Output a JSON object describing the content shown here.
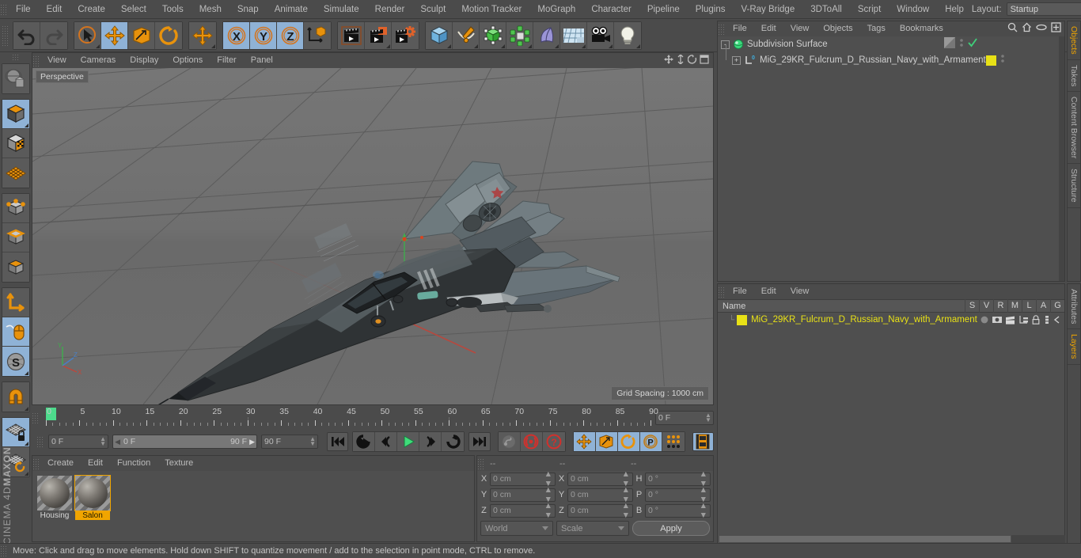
{
  "app": {
    "brand_top": "MAXON",
    "brand_bottom": "CINEMA 4D"
  },
  "topmenu": {
    "items": [
      "File",
      "Edit",
      "Create",
      "Select",
      "Tools",
      "Mesh",
      "Snap",
      "Animate",
      "Simulate",
      "Render",
      "Sculpt",
      "Motion Tracker",
      "MoGraph",
      "Character",
      "Pipeline",
      "Plugins",
      "V-Ray Bridge",
      "3DToAll",
      "Script",
      "Window",
      "Help"
    ],
    "layout_label": "Layout:",
    "layout_value": "Startup",
    "search_icon": "search-icon"
  },
  "toolbar": {
    "groups": [
      {
        "name": "undo-redo",
        "buttons": [
          {
            "name": "undo",
            "icon": "undo-arrow-icon",
            "selected": false,
            "corner": false
          },
          {
            "name": "redo",
            "icon": "redo-arrow-icon",
            "selected": false,
            "corner": false
          }
        ]
      },
      {
        "name": "transform",
        "buttons": [
          {
            "name": "live-selection",
            "icon": "cursor-circle-icon",
            "selected": false,
            "corner": true
          },
          {
            "name": "move",
            "icon": "move-cross-icon",
            "selected": true,
            "corner": false
          },
          {
            "name": "scale",
            "icon": "scale-box-icon",
            "selected": false,
            "corner": false
          },
          {
            "name": "rotate",
            "icon": "rotate-icon",
            "selected": false,
            "corner": false
          }
        ]
      },
      {
        "name": "move-duplicate",
        "buttons": [
          {
            "name": "move-tool-2",
            "icon": "move-cross-icon",
            "selected": false,
            "corner": true
          }
        ]
      },
      {
        "name": "axis-lock",
        "buttons": [
          {
            "name": "lock-x",
            "icon": "x-axis-icon",
            "selected": true,
            "corner": false
          },
          {
            "name": "lock-y",
            "icon": "y-axis-icon",
            "selected": true,
            "corner": false
          },
          {
            "name": "lock-z",
            "icon": "z-axis-icon",
            "selected": true,
            "corner": false
          },
          {
            "name": "world-object-coords",
            "icon": "world-axis-cube-icon",
            "selected": false,
            "corner": false
          }
        ]
      },
      {
        "name": "render",
        "buttons": [
          {
            "name": "render-view",
            "icon": "clapperboard-icon",
            "selected": false,
            "corner": false
          },
          {
            "name": "render-region",
            "icon": "clapperboard-region-icon",
            "selected": false,
            "corner": true
          },
          {
            "name": "render-settings",
            "icon": "clapperboard-gear-icon",
            "selected": false,
            "corner": false
          }
        ]
      },
      {
        "name": "create",
        "buttons": [
          {
            "name": "add-cube",
            "icon": "cube-icon",
            "selected": false,
            "corner": true
          },
          {
            "name": "add-spline",
            "icon": "pen-spline-icon",
            "selected": false,
            "corner": true
          },
          {
            "name": "add-nurbs",
            "icon": "green-cube-generator-icon",
            "selected": false,
            "corner": true
          },
          {
            "name": "add-array",
            "icon": "green-array-icon",
            "selected": false,
            "corner": true
          },
          {
            "name": "add-deformer",
            "icon": "bend-deformer-icon",
            "selected": false,
            "corner": true
          },
          {
            "name": "add-environment",
            "icon": "floor-grid-icon",
            "selected": false,
            "corner": true
          },
          {
            "name": "add-camera",
            "icon": "camera-icon",
            "selected": false,
            "corner": true
          },
          {
            "name": "add-light",
            "icon": "light-bulb-icon",
            "selected": false,
            "corner": true
          }
        ]
      }
    ]
  },
  "lefttools": {
    "groups": [
      {
        "name": "globe",
        "buttons": [
          {
            "name": "make-editable",
            "icon": "globe-wire-icon",
            "selected": false,
            "corner": false
          }
        ]
      },
      {
        "name": "mode-model",
        "buttons": [
          {
            "name": "model-mode",
            "icon": "grey-cube-icon",
            "selected": true,
            "corner": true
          },
          {
            "name": "texture-mode",
            "icon": "checker-cube-icon",
            "selected": false,
            "corner": false
          },
          {
            "name": "uv-mesh-mode",
            "icon": "orange-mesh-icon",
            "selected": false,
            "corner": false
          }
        ]
      },
      {
        "name": "mode-components",
        "buttons": [
          {
            "name": "points-mode",
            "icon": "points-cube-icon",
            "selected": false,
            "corner": false
          },
          {
            "name": "edges-mode",
            "icon": "edges-cube-icon",
            "selected": false,
            "corner": false
          },
          {
            "name": "polygons-mode",
            "icon": "polygons-cube-icon",
            "selected": false,
            "corner": false
          }
        ]
      },
      {
        "name": "axis",
        "buttons": [
          {
            "name": "enable-axis",
            "icon": "axis-corner-icon",
            "selected": false,
            "corner": false
          },
          {
            "name": "viewport-solo",
            "icon": "mouse-icon",
            "selected": true,
            "corner": false
          },
          {
            "name": "workplane",
            "icon": "s-disc-icon",
            "selected": true,
            "corner": true
          }
        ]
      },
      {
        "name": "snap",
        "buttons": [
          {
            "name": "enable-snap",
            "icon": "magnet-icon",
            "selected": false,
            "corner": true
          }
        ]
      },
      {
        "name": "workplane-lock",
        "buttons": [
          {
            "name": "lock-workplane",
            "icon": "grid-lock-icon",
            "selected": true,
            "corner": true
          },
          {
            "name": "planar-workplane",
            "icon": "grid-rotate-icon",
            "selected": false,
            "corner": true
          }
        ]
      }
    ]
  },
  "viewport": {
    "menu": [
      "View",
      "Cameras",
      "Display",
      "Options",
      "Filter",
      "Panel"
    ],
    "view_label": "Perspective",
    "grid_spacing": "Grid Spacing : 1000 cm",
    "axis_labels": {
      "x": "X",
      "y": "Y",
      "z": "Z"
    },
    "corner_icons": [
      "move-view-icon",
      "scale-view-icon",
      "rotate-view-icon",
      "maximize-view-icon"
    ]
  },
  "timeline": {
    "ticks": [
      0,
      5,
      10,
      15,
      20,
      25,
      30,
      35,
      40,
      45,
      50,
      55,
      60,
      65,
      70,
      75,
      80,
      85,
      90
    ],
    "current_frame_field": "0 F",
    "playhead_frame": 0
  },
  "playbar": {
    "current_frame": "0 F",
    "range_start": "0 F",
    "range_end": "90 F",
    "end_frame": "90 F",
    "buttons": [
      {
        "name": "go-to-start",
        "icon": "skip-start-icon",
        "selected": false
      },
      {
        "name": "play-reverse-loop",
        "icon": "loop-back-icon",
        "selected": false
      },
      {
        "name": "step-back",
        "icon": "step-back-icon",
        "selected": false
      },
      {
        "name": "play-forward",
        "icon": "play-icon",
        "selected": false
      },
      {
        "name": "step-forward",
        "icon": "step-forward-icon",
        "selected": false
      },
      {
        "name": "loop-forward",
        "icon": "loop-forward-icon",
        "selected": false
      },
      {
        "name": "go-to-end",
        "icon": "skip-end-icon",
        "selected": false
      }
    ],
    "record_buttons": [
      {
        "name": "autokey-toggle",
        "icon": "key-icon",
        "selected": false
      },
      {
        "name": "record-active-objects",
        "icon": "record-circle-icon",
        "selected": false
      },
      {
        "name": "autokeying",
        "icon": "question-record-icon",
        "selected": false
      }
    ],
    "key_param_buttons": [
      {
        "name": "key-position",
        "icon": "move-cross-icon",
        "selected": true
      },
      {
        "name": "key-scale",
        "icon": "scale-box-icon",
        "selected": true
      },
      {
        "name": "key-rotation",
        "icon": "rotate-icon",
        "selected": true
      },
      {
        "name": "key-parameter",
        "icon": "p-circle-icon",
        "selected": true
      },
      {
        "name": "key-point-level",
        "icon": "dots-grid-icon",
        "selected": false
      }
    ],
    "timeline_toggle": {
      "name": "show-timeline",
      "icon": "filmstrip-icon",
      "selected": true
    }
  },
  "materials": {
    "menu": [
      "Create",
      "Edit",
      "Function",
      "Texture"
    ],
    "items": [
      {
        "name": "Housing",
        "selected": false
      },
      {
        "name": "Salon",
        "selected": true
      }
    ]
  },
  "coordinates": {
    "headers": [
      "--",
      "--",
      "--"
    ],
    "rows": [
      {
        "ax1": "X",
        "v1": "0 cm",
        "ax2": "X",
        "v2": "0 cm",
        "ax3": "H",
        "v3": "0 °"
      },
      {
        "ax1": "Y",
        "v1": "0 cm",
        "ax2": "Y",
        "v2": "0 cm",
        "ax3": "P",
        "v3": "0 °"
      },
      {
        "ax1": "Z",
        "v1": "0 cm",
        "ax2": "Z",
        "v2": "0 cm",
        "ax3": "B",
        "v3": "0 °"
      }
    ],
    "system": "World",
    "mode": "Scale",
    "apply_label": "Apply"
  },
  "objects": {
    "menu": [
      "File",
      "Edit",
      "View",
      "Objects",
      "Tags",
      "Bookmarks"
    ],
    "header_icons": [
      "search-icon",
      "home-icon",
      "ellipse-icon",
      "plus-box-icon"
    ],
    "tree": [
      {
        "name": "Subdivision Surface",
        "icon": "subdivision-surface-icon",
        "expander": "-",
        "indent": 0,
        "tag_color": "",
        "has_checkmark": true
      },
      {
        "name": "MiG_29KR_Fulcrum_D_Russian_Navy_with_Armament",
        "icon": "null-object-icon",
        "expander": "+",
        "indent": 1,
        "tag_color": "#e8e116",
        "has_checkmark": false
      }
    ],
    "side_tabs": [
      "Objects",
      "Takes",
      "Content Browser",
      "Structure"
    ]
  },
  "layers": {
    "menu": [
      "File",
      "Edit",
      "View"
    ],
    "columns": [
      "Name",
      "S",
      "V",
      "R",
      "M",
      "L",
      "A",
      "G"
    ],
    "rows": [
      {
        "name": "MiG_29KR_Fulcrum_D_Russian_Navy_with_Armament",
        "color": "#e8e116"
      }
    ],
    "side_tabs": [
      "Attributes",
      "Layers"
    ]
  },
  "statusbar": {
    "text": "Move: Click and drag to move elements. Hold down SHIFT to quantize movement / add to the selection in point mode, CTRL to remove."
  },
  "colors": {
    "accent_orange": "#f0a500",
    "selection_blue": "#8fb2d6",
    "layer_yellow": "#e8e116",
    "panel_bg": "#4b4b4b",
    "viewport_bg": "#6f6f6f"
  }
}
